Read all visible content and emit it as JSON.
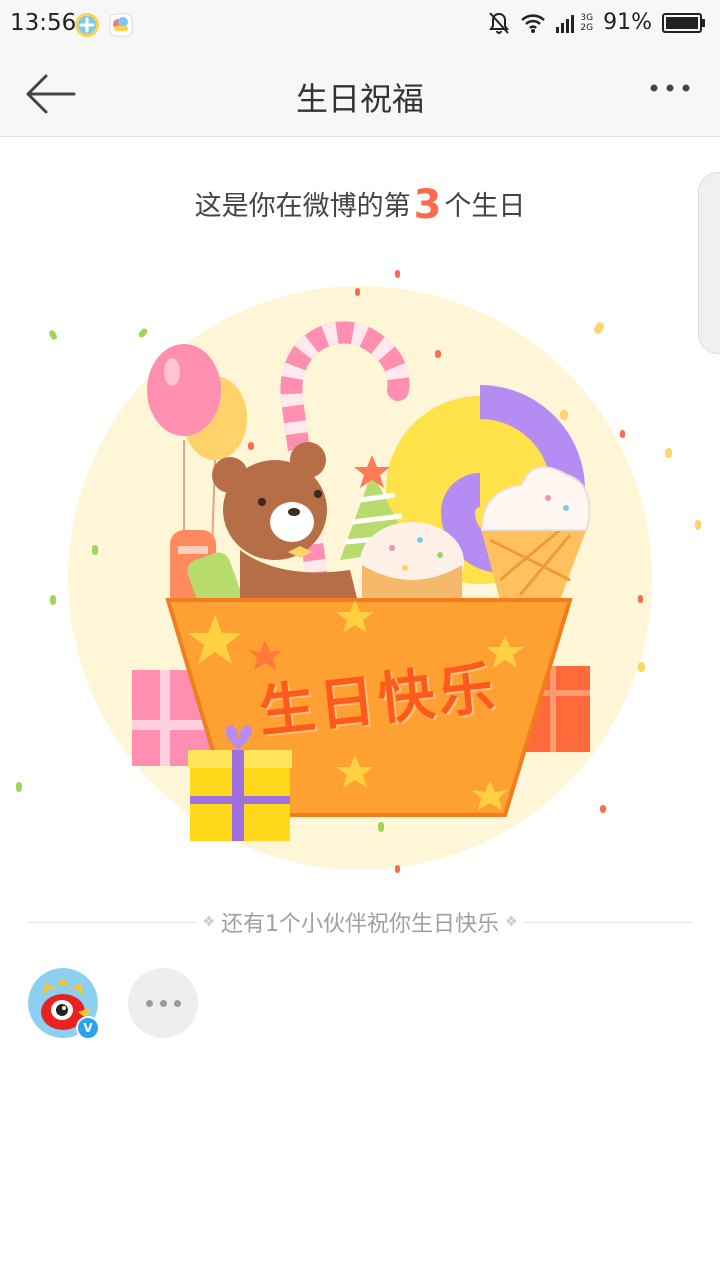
{
  "status_bar": {
    "time": "13:56",
    "battery": "91%",
    "network": [
      "3G",
      "2G"
    ],
    "icons": [
      "plus-app-icon",
      "weather-app-icon",
      "mute-icon",
      "wifi-icon",
      "signal-icon",
      "battery-icon"
    ]
  },
  "nav": {
    "title": "生日祝福",
    "back_icon": "back-arrow-icon",
    "more_icon": "more-dots-icon"
  },
  "headline": {
    "prefix": "这是你在微博的第",
    "number": "3",
    "suffix": "个生日"
  },
  "illustration": {
    "banner_text": "生日快乐",
    "circle_color": "#fff6d8",
    "basket_color": "#ffa033"
  },
  "friends": {
    "label": "还有1个小伙伴祝你生日快乐",
    "avatars": [
      {
        "name": "weibo-mascot-avatar",
        "verified": true
      }
    ],
    "more_icon": "more-friends-icon"
  },
  "colors": {
    "accent": "#ff6a4d",
    "verified": "#2aa3ee"
  }
}
